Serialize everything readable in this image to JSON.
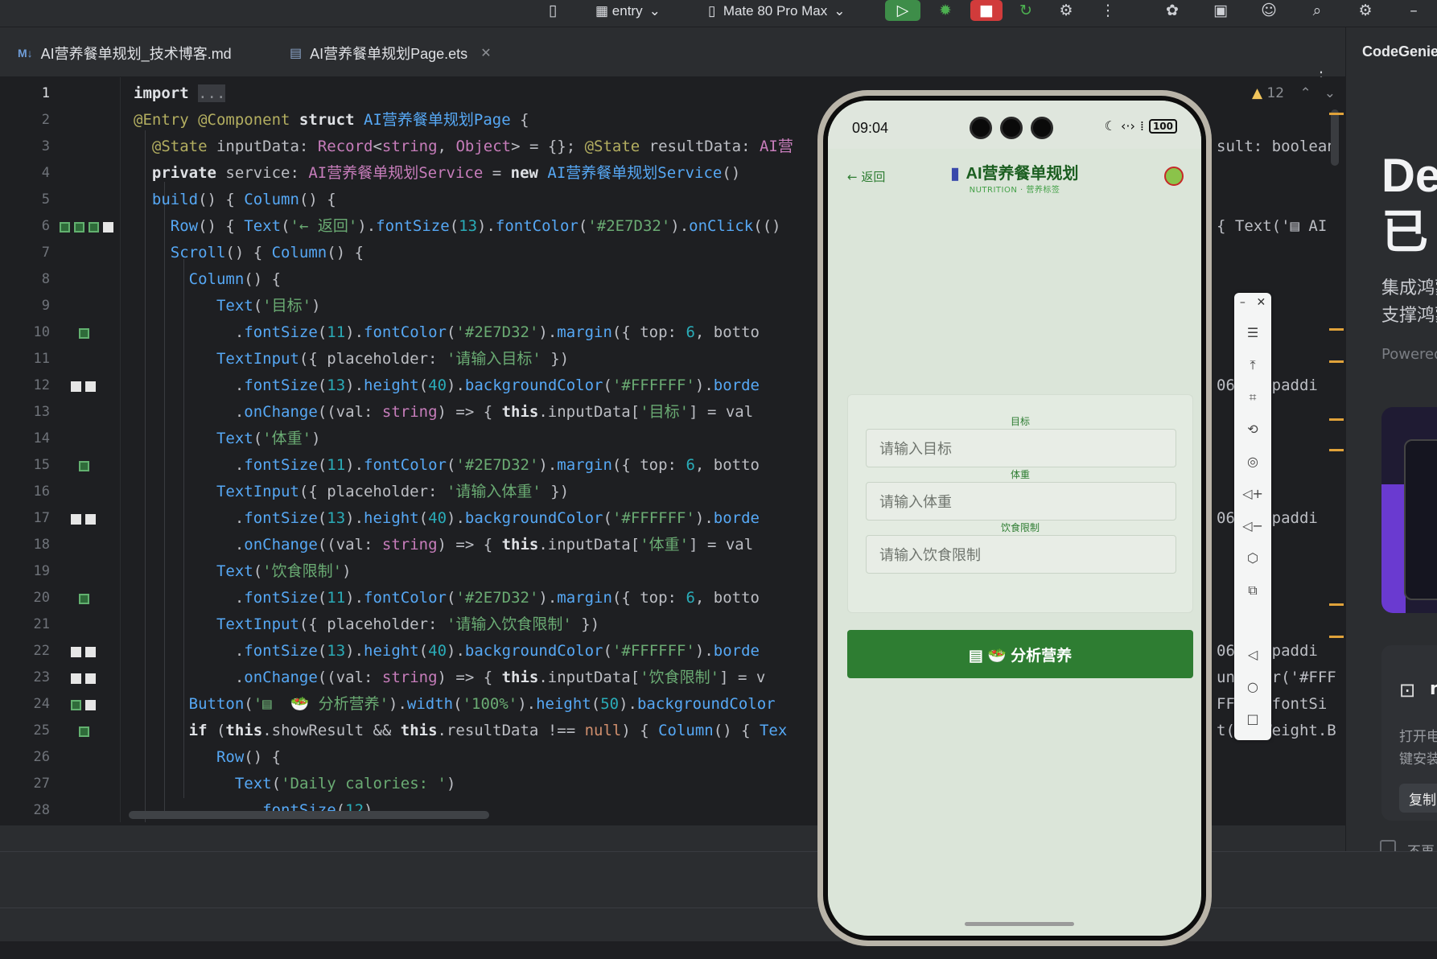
{
  "toolbar": {
    "module": "entry",
    "device": "Mate 80 Pro Max",
    "icons": [
      "device-icon",
      "module-icon",
      "phone-icon",
      "run-icon",
      "debug-icon",
      "stop-icon",
      "sync-icon",
      "profile-icon",
      "more-icon",
      "settings-icon",
      "layout-icon",
      "account-icon",
      "search-icon",
      "gear-icon"
    ]
  },
  "tabs": [
    {
      "prefix": "M↓",
      "label": "AI营养餐单规划_技术博客.md"
    },
    {
      "prefix": "▤",
      "label": "AI营养餐单规划Page.ets"
    }
  ],
  "right_panel": {
    "title": "CodeGenie",
    "heading1": "De",
    "heading2": "已",
    "sub1": "集成鸿蒙",
    "sub2": "支撑鸿蒙",
    "powered": "Powered",
    "box_title": "n",
    "box_text1": "打开电",
    "box_text2": "键安装",
    "copy_btn": "复制",
    "checkbox_label": "不再"
  },
  "editor": {
    "warnings": "12",
    "lines": [
      {
        "n": "1"
      },
      {
        "n": "2"
      },
      {
        "n": "3"
      },
      {
        "n": "4"
      },
      {
        "n": "5"
      },
      {
        "n": "6"
      },
      {
        "n": "7"
      },
      {
        "n": "8"
      },
      {
        "n": "9"
      },
      {
        "n": "10"
      },
      {
        "n": "11"
      },
      {
        "n": "12"
      },
      {
        "n": "13"
      },
      {
        "n": "14"
      },
      {
        "n": "15"
      },
      {
        "n": "16"
      },
      {
        "n": "17"
      },
      {
        "n": "18"
      },
      {
        "n": "19"
      },
      {
        "n": "20"
      },
      {
        "n": "21"
      },
      {
        "n": "22"
      },
      {
        "n": "23"
      },
      {
        "n": "24"
      },
      {
        "n": "25"
      },
      {
        "n": "26"
      },
      {
        "n": "27"
      },
      {
        "n": "28"
      }
    ],
    "code_right": {
      "l3": "sult: boolean",
      "l6": "{ Text('▤ AI",
      "l12": "06/-).paddi",
      "l17": "06/-).paddi",
      "l22": "06/-).paddi",
      "l23": "un   or('#FFF",
      "l24": "FF   .fontSi",
      "l25": "t(F  Weight.B"
    }
  },
  "phone": {
    "time": "09:04",
    "battery": "100",
    "back": "← 返回",
    "title": "AI营养餐单规划",
    "subtitle": "NUTRITION · 营养标签",
    "fields": [
      {
        "label": "目标",
        "placeholder": "请输入目标"
      },
      {
        "label": "体重",
        "placeholder": "请输入体重"
      },
      {
        "label": "饮食限制",
        "placeholder": "请输入饮食限制"
      }
    ],
    "button": "▤ 🥗 分析营养"
  }
}
